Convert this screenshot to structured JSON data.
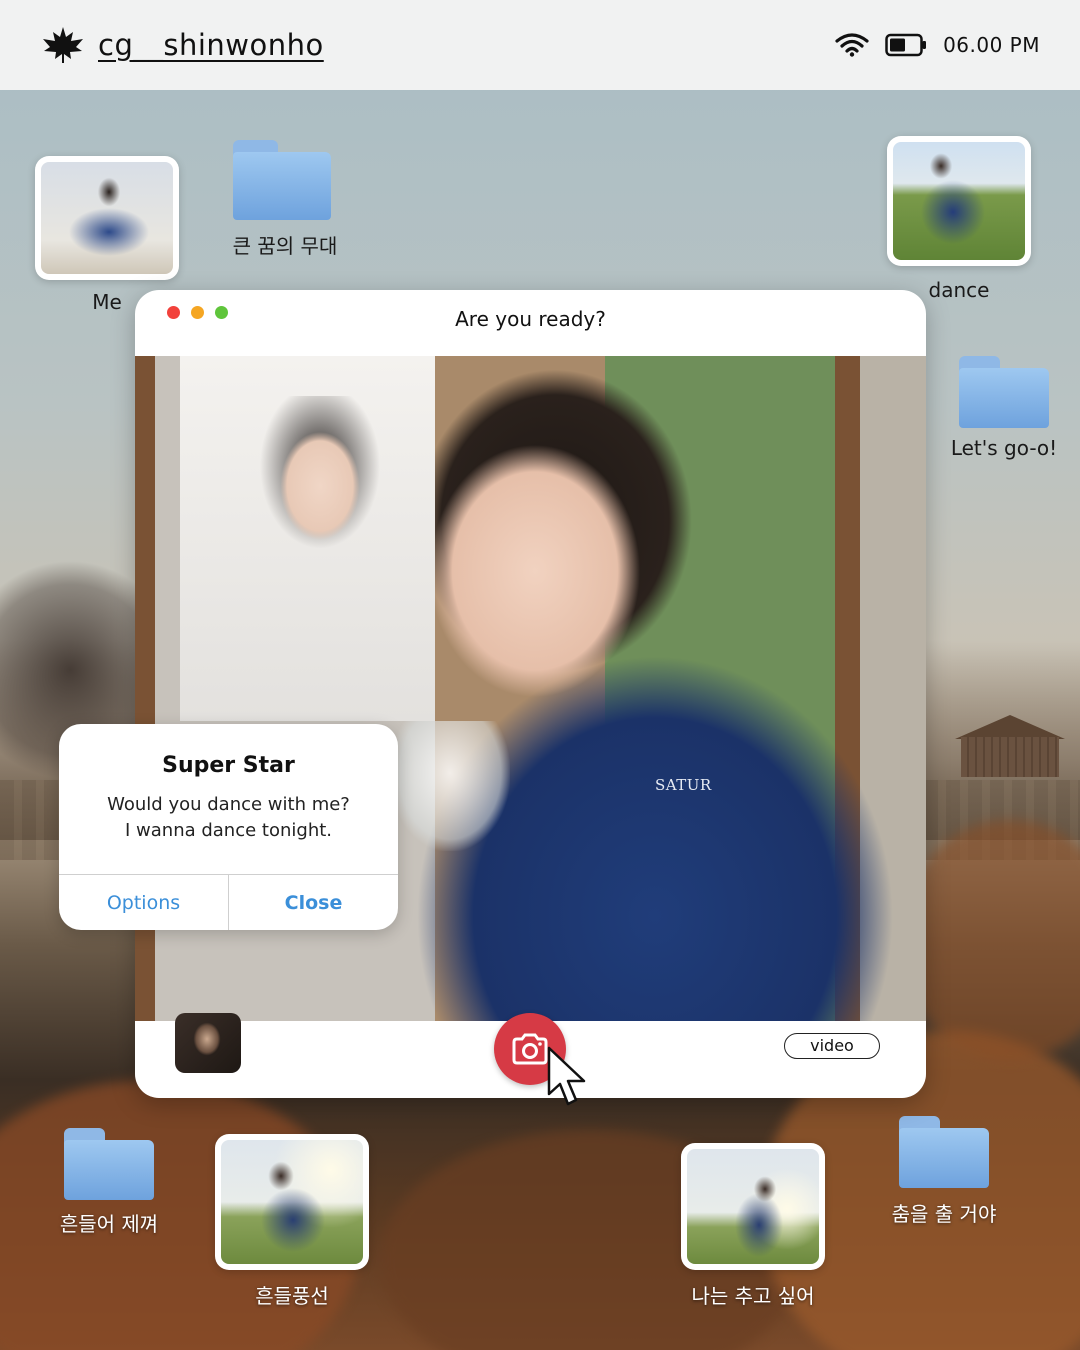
{
  "statusbar": {
    "username": "cg__shinwonho",
    "time": "06.00 PM"
  },
  "desktop": {
    "me_label": "Me",
    "folder_big_dream_label": "큰 꿈의 무대",
    "dance_label": "dance",
    "folder_lets_go_label": "Let's go-o!",
    "folder_shake_label": "흔들어 제껴",
    "photo_balloon_label": "흔들풍선",
    "photo_want_dance_label": "나는 추고 싶어",
    "folder_gonna_dance_label": "춤을 출 거야"
  },
  "window": {
    "title": "Are you ready?",
    "video_label": "video",
    "jacket_text": "SATUR",
    "dot_colors": [
      "#f2413b",
      "#f5a623",
      "#5fc53b"
    ]
  },
  "dialog": {
    "title": "Super Star",
    "line1": "Would you dance with me?",
    "line2": "I wanna dance tonight.",
    "options_label": "Options",
    "close_label": "Close"
  },
  "colors": {
    "accent_blue": "#3b8fd9",
    "camera_red": "#d63a45",
    "statusbar_bg": "#f1f2f2"
  }
}
